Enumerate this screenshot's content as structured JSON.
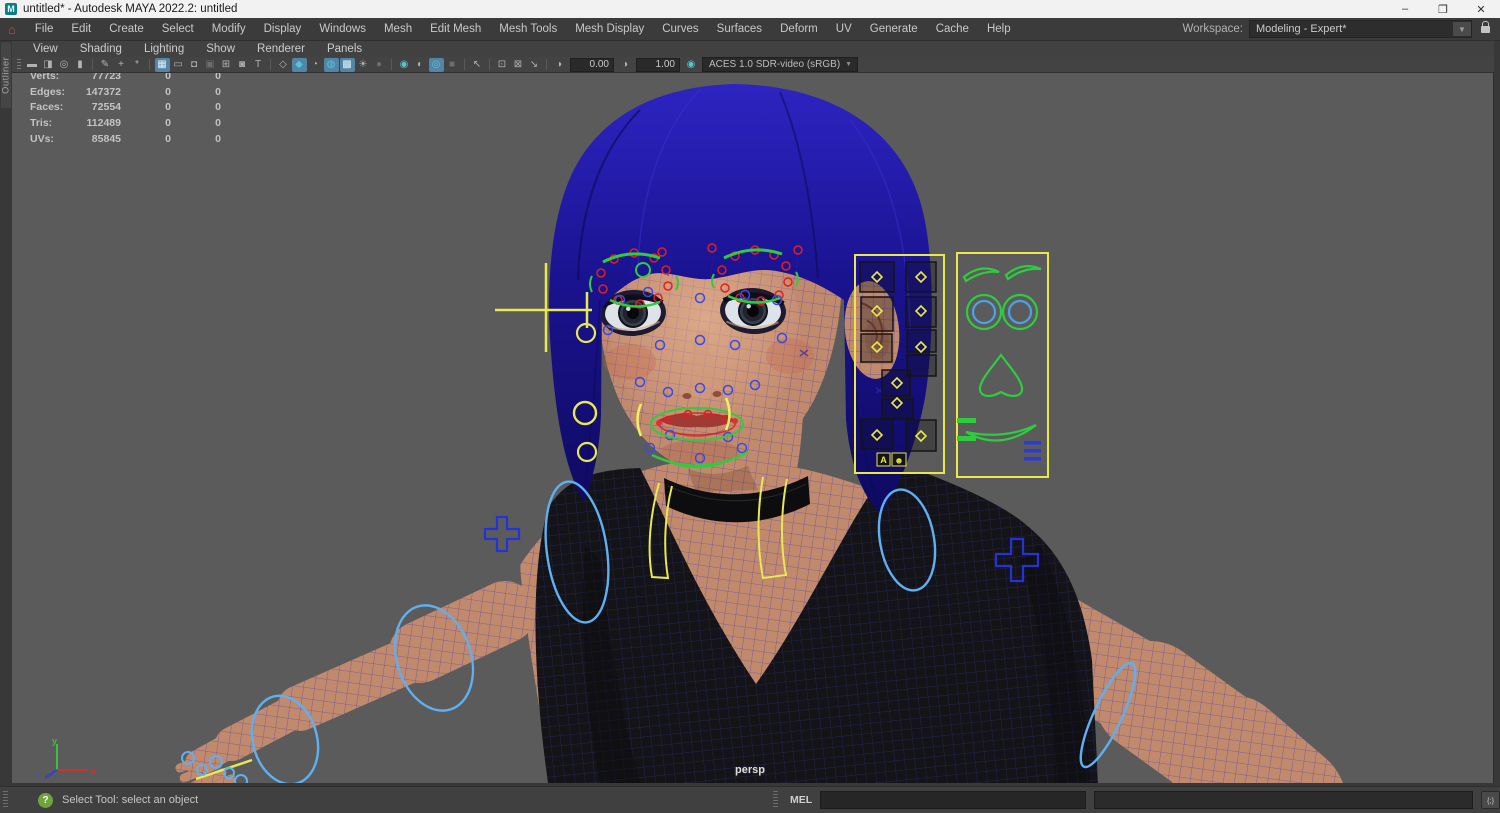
{
  "window": {
    "title": "untitled* - Autodesk MAYA 2022.2: untitled",
    "app_initial": "M",
    "minimize": "–",
    "maximize": "❐",
    "close": "✕"
  },
  "menu_bar": {
    "home_icon": "⌂",
    "items": [
      "File",
      "Edit",
      "Create",
      "Select",
      "Modify",
      "Display",
      "Windows",
      "Mesh",
      "Edit Mesh",
      "Mesh Tools",
      "Mesh Display",
      "Curves",
      "Surfaces",
      "Deform",
      "UV",
      "Generate",
      "Cache",
      "Help"
    ],
    "workspace_label": "Workspace:",
    "workspace_value": "Modeling - Expert*",
    "dropdown_arrow": "▼"
  },
  "panel_menu": {
    "items": [
      "View",
      "Shading",
      "Lighting",
      "Show",
      "Renderer",
      "Panels"
    ]
  },
  "viewport_toolbar": {
    "icons": [
      {
        "name": "camera-icon",
        "glyph": "▬"
      },
      {
        "name": "camera-lock-icon",
        "glyph": "◨"
      },
      {
        "name": "camera-attributes-icon",
        "glyph": "◎"
      },
      {
        "name": "bookmark-icon",
        "glyph": "▮"
      },
      {
        "name": "image-plane-icon",
        "glyph": "✎"
      },
      {
        "name": "pan-zoom-icon",
        "glyph": "+"
      },
      {
        "name": "oversean-icon",
        "glyph": "*"
      },
      {
        "name": "grid-icon",
        "glyph": "▦"
      },
      {
        "name": "film-gate-icon",
        "glyph": "▭"
      },
      {
        "name": "resolution-gate-icon",
        "glyph": "◘"
      },
      {
        "name": "gate-mask-icon",
        "glyph": "▣"
      },
      {
        "name": "field-chart-icon",
        "glyph": "⊞"
      },
      {
        "name": "safe-title-icon",
        "glyph": "◙"
      },
      {
        "name": "hud-icon",
        "glyph": "T"
      },
      {
        "name": "wireframe-icon",
        "glyph": "◇"
      },
      {
        "name": "smooth-shade-icon",
        "glyph": "◆"
      },
      {
        "name": "bonus-shade-icon",
        "glyph": "◔"
      },
      {
        "name": "textured-icon",
        "glyph": "◍"
      },
      {
        "name": "checker-icon",
        "glyph": "▩"
      },
      {
        "name": "lights-icon",
        "glyph": "☀"
      },
      {
        "name": "shadows-icon",
        "glyph": "●"
      },
      {
        "name": "ao-icon",
        "glyph": "◉"
      },
      {
        "name": "motion-blur-icon",
        "glyph": "◐"
      },
      {
        "name": "multisample-icon",
        "glyph": "◎"
      },
      {
        "name": "greyscale-icon",
        "glyph": "■"
      },
      {
        "name": "isolate-select-icon",
        "glyph": "↖"
      },
      {
        "name": "snapshot-copy-icon",
        "glyph": "⊡"
      },
      {
        "name": "snapshot-paste-icon",
        "glyph": "⊠"
      },
      {
        "name": "region-tool-icon",
        "glyph": "↘"
      },
      {
        "name": "exposure-icon",
        "glyph": "◑"
      },
      {
        "name": "gamma-icon",
        "glyph": "◑"
      },
      {
        "name": "color-managed-icon",
        "glyph": "◉"
      }
    ],
    "exposure_value": "0.00",
    "gamma_value": "1.00",
    "colorspace": "ACES 1.0 SDR-video (sRGB)",
    "dropdown_arrow": "▼"
  },
  "outliner_tab": {
    "label": "Outliner"
  },
  "hud": {
    "rows": [
      {
        "label": "Verts:",
        "total": "77723",
        "col2": "0",
        "col3": "0"
      },
      {
        "label": "Edges:",
        "total": "147372",
        "col2": "0",
        "col3": "0"
      },
      {
        "label": "Faces:",
        "total": "72554",
        "col2": "0",
        "col3": "0"
      },
      {
        "label": "Tris:",
        "total": "112489",
        "col2": "0",
        "col3": "0"
      },
      {
        "label": "UVs:",
        "total": "85845",
        "col2": "0",
        "col3": "0"
      }
    ]
  },
  "viewport": {
    "camera_label": "persp",
    "axis_x": "x",
    "axis_y": "y",
    "axis_z": "z"
  },
  "picker_panel": {
    "button_a": "A",
    "button_smiley": "☻"
  },
  "status_bar": {
    "help_icon": "?",
    "help_text": "Select Tool: select an object",
    "mel_label": "MEL",
    "mel_input_value": "",
    "script_editor_icon": "{;}"
  },
  "colors": {
    "accent_blue": "#5285a6",
    "teal": "#53c6d2",
    "hud_yellow": "#e8e84a",
    "control_green": "#2ecc3e",
    "control_blue": "#2333d8",
    "light_blue": "#5fb0f0",
    "skin": "#c28a6d",
    "hair": "#1a1390",
    "viewport_bg": "#5b5b5b"
  }
}
